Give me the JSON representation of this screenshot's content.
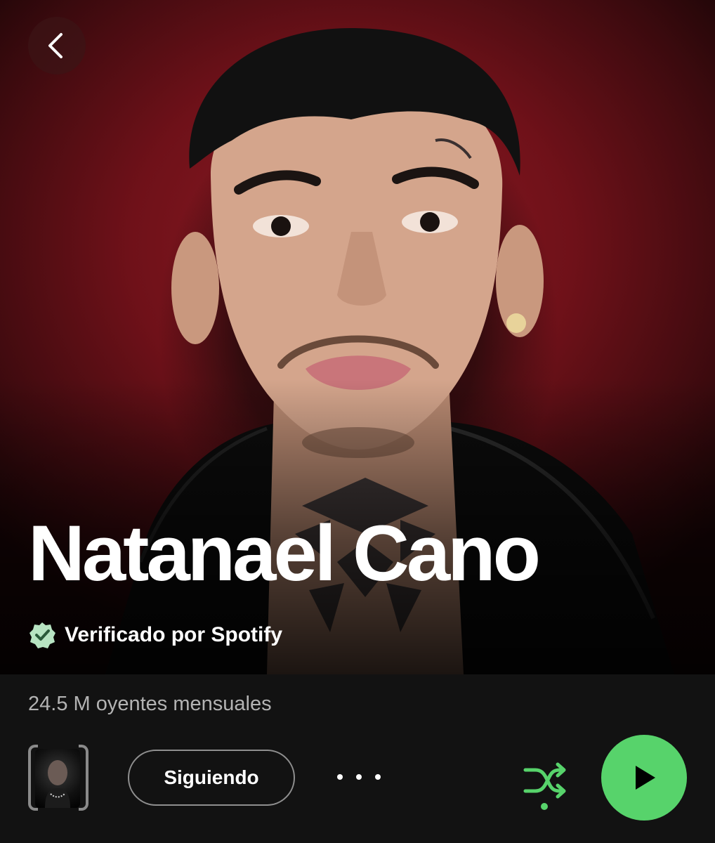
{
  "header": {
    "back_icon": "chevron-left-icon"
  },
  "artist": {
    "name": "Natanael Cano",
    "verified_text": "Verificado por Spotify",
    "verified_icon": "verified-badge-icon",
    "monthly_listeners": "24.5 M oyentes mensuales"
  },
  "actions": {
    "follow_label": "Siguiendo",
    "more_icon": "more-options-icon",
    "shuffle_icon": "shuffle-icon",
    "play_icon": "play-icon",
    "thumbnail_icon": "artist-preview-thumbnail"
  },
  "colors": {
    "accent_green": "#57d36b",
    "hero_red": "#8e1b24",
    "background": "#121212",
    "secondary_text": "#b3b3b3"
  }
}
